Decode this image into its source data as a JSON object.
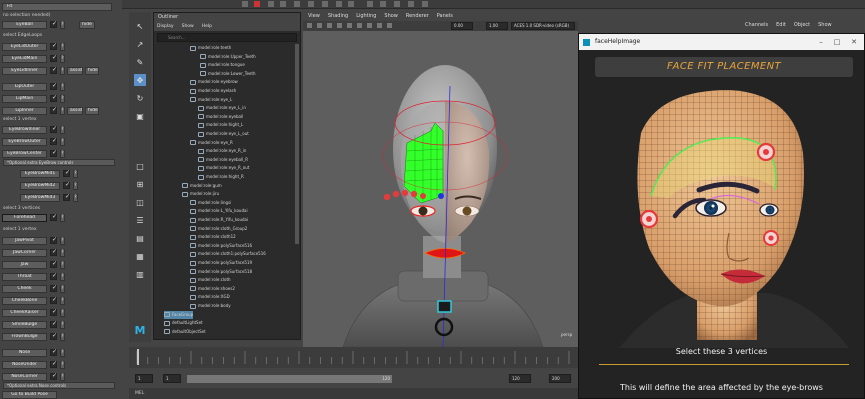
{
  "left_panel": {
    "header_fit": "Fit",
    "note_no_selection": "no selection needed)",
    "hide_label": "hide",
    "assist_label": "assist",
    "section_edgeloops": "select EdgeLoops",
    "section_1_vertex": "select 1 vertex",
    "section_3_vertices": "select 3 vertices",
    "section_1_vertex_b": "select 1 vertex",
    "optional_eyebrow": "*Optional extra EyeBrow controls",
    "optional_nose": "*Optional extra Nose controls",
    "buttons": {
      "eyeball": "EyeBall",
      "eyelidouter": "EyeLidOuter",
      "eyelidmain": "EyeLidMain",
      "eyelidinner": "EyeLidInner",
      "lipouter": "LipOuter",
      "lipmain": "LipMain",
      "lipinner": "LipInner",
      "eyebrowinner": "EyeBrowInner",
      "eyebrowouter": "EyeBrowOuter",
      "eyebrowcenter": "EyeBrowCenter",
      "eyebrowmid1": "EyeBrowMid1",
      "eyebrowmid2": "EyeBrowMid2",
      "eyebrowmid3": "EyeBrowMid3",
      "forehead": "Forehead",
      "jawpivot": "JawPivot",
      "jawcorner": "JawCorner",
      "jaw": "Jaw",
      "throat": "Throat",
      "cheek": "Cheek",
      "cheekbone": "CheekBone",
      "cheekraiser": "CheekRaiser",
      "smilebulge": "SmileBulge",
      "frownbulge": "FrownBulge",
      "nose": "Nose",
      "noseunder": "NoseUnder",
      "nosecorner": "NoseCorner",
      "build": "Go to Build Pose"
    }
  },
  "outliner": {
    "title": "Outliner",
    "menu": [
      "Display",
      "Show",
      "Help"
    ],
    "search_placeholder": "Search...",
    "items": [
      "model:role:teeth",
      "model:role:Upper_Teeth",
      "model:role:tongue",
      "model:role:Lower_Teeth",
      "model:role:eyebrow",
      "model:role:eyelash",
      "model:role:eye_L",
      "model:role:eye_L_in",
      "model:role:eyeball",
      "model:role:hight_L",
      "model:role:eye_L_out",
      "model:role:eye_R",
      "model:role:eye_R_in",
      "model:role:eyeball_R",
      "model:role:eye_R_out",
      "model:role:hight_R",
      "model:role:gum",
      "model:role:jiru",
      "model:role:lingsi",
      "model:role:L_Yifu_koudai",
      "model:role:R_Yifu_koudai",
      "model:role:cloth_Group2",
      "model:role:cloth12",
      "model:role:polySurface516",
      "model:role:cloth1:polySurface516",
      "model:role:polySurface519",
      "model:role:polySurface518",
      "model:role:cloth",
      "model:role:shoes2",
      "model:role:XGD",
      "model:role:body",
      "FaceGroup",
      "defaultLightSet",
      "defaultObjectSet"
    ]
  },
  "viewport": {
    "menu": [
      "View",
      "Shading",
      "Lighting",
      "Show",
      "Renderer",
      "Panels"
    ],
    "field_a": "0.00",
    "field_b": "1.00",
    "colorspace": "ACES 1.0 SDR-video (sRGB)",
    "cam_label": "persp"
  },
  "right_panel": {
    "menu": [
      "Channels",
      "Edit",
      "Object",
      "Show"
    ]
  },
  "help_window": {
    "title": "faceHelpImage",
    "minimize": "–",
    "maximize": "□",
    "close": "✕",
    "heading": "FACE FIT PLACEMENT",
    "instruction": "Select these 3 vertices",
    "description": "This will define the area affected by the eye-brows"
  },
  "timeline": {
    "start": "1",
    "start2": "1",
    "mid": "120",
    "end": "120",
    "end2": "200",
    "cmd_label": "MEL"
  },
  "colors": {
    "accent_orange": "#e9a43a",
    "maya_blue": "#5b8fc7",
    "highlight_green": "#33ff2a",
    "marker_red": "#e63a3a"
  }
}
